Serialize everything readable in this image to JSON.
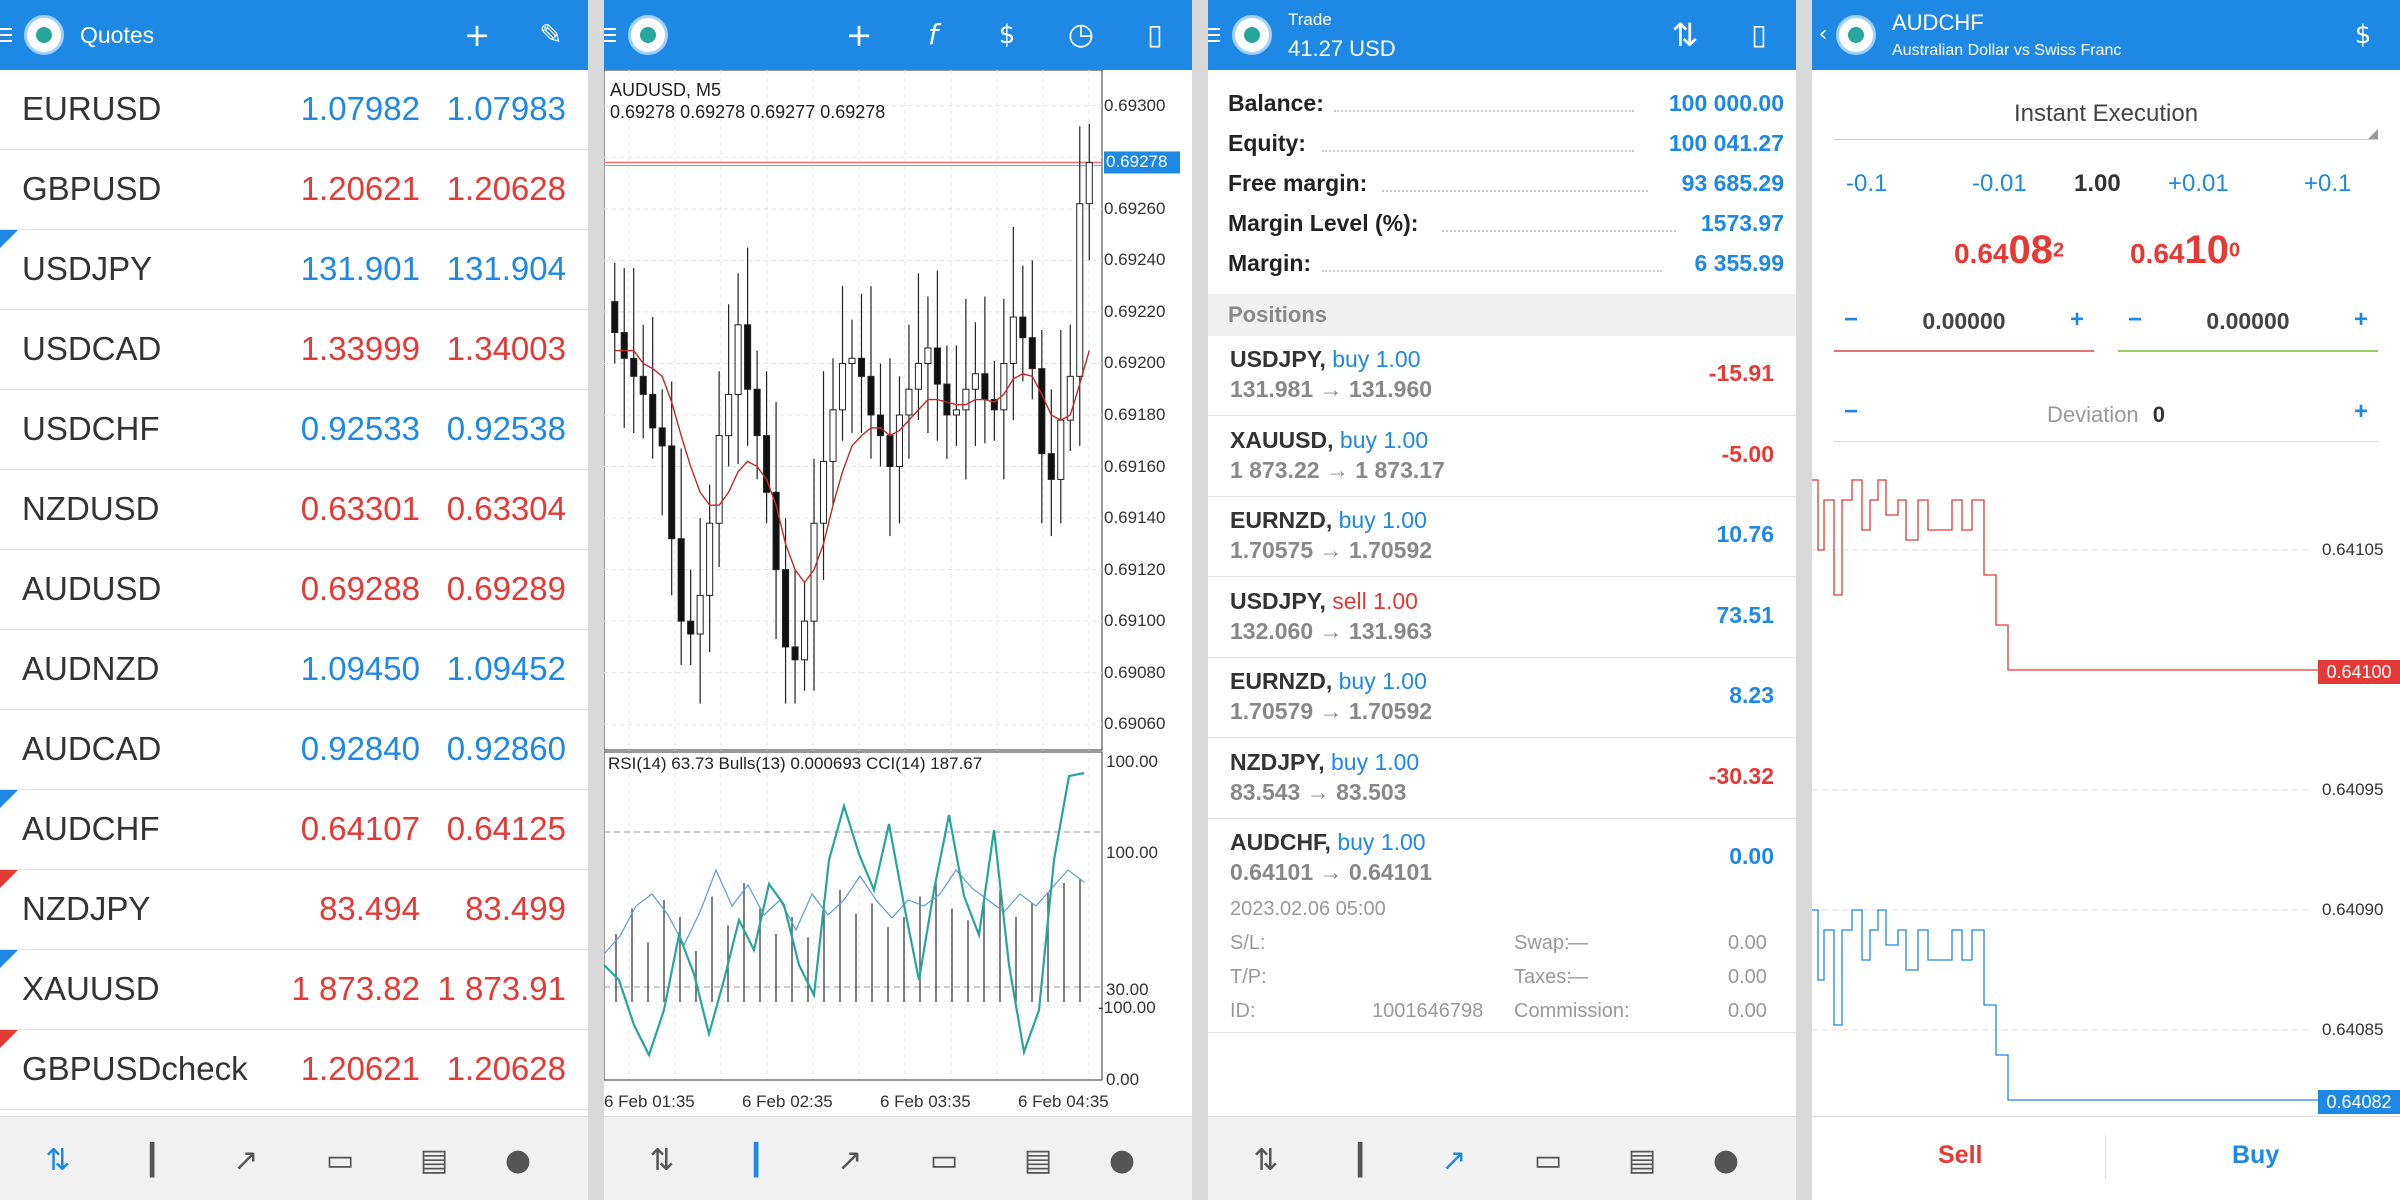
{
  "colors": {
    "accent": "#1e88e5",
    "up": "#1e88e5",
    "down": "#e53935"
  },
  "bottom_nav": [
    "quotes-icon",
    "chart-icon",
    "trade-icon",
    "history-icon",
    "news-icon",
    "chat-icon"
  ],
  "quotes": {
    "title": "Quotes",
    "rows": [
      {
        "symbol": "EURUSD",
        "bid": "1.07982",
        "ask": "1.07983",
        "dir": "up"
      },
      {
        "symbol": "GBPUSD",
        "bid": "1.20621",
        "ask": "1.20628",
        "dir": "down"
      },
      {
        "symbol": "USDJPY",
        "bid": "131.901",
        "ask": "131.904",
        "dir": "up"
      },
      {
        "symbol": "USDCAD",
        "bid": "1.33999",
        "ask": "1.34003",
        "dir": "down"
      },
      {
        "symbol": "USDCHF",
        "bid": "0.92533",
        "ask": "0.92538",
        "dir": "up"
      },
      {
        "symbol": "NZDUSD",
        "bid": "0.63301",
        "ask": "0.63304",
        "dir": "down"
      },
      {
        "symbol": "AUDUSD",
        "bid": "0.69288",
        "ask": "0.69289",
        "dir": "down"
      },
      {
        "symbol": "AUDNZD",
        "bid": "1.09450",
        "ask": "1.09452",
        "dir": "up"
      },
      {
        "symbol": "AUDCAD",
        "bid": "0.92840",
        "ask": "0.92860",
        "dir": "up"
      },
      {
        "symbol": "AUDCHF",
        "bid": "0.64107",
        "ask": "0.64125",
        "dir": "down"
      },
      {
        "symbol": "NZDJPY",
        "bid": "83.494",
        "ask": "83.499",
        "dir": "down"
      },
      {
        "symbol": "XAUUSD",
        "bid": "1 873.82",
        "ask": "1 873.91",
        "dir": "down"
      },
      {
        "symbol": "GBPUSDcheck",
        "bid": "1.20621",
        "ask": "1.20628",
        "dir": "down"
      }
    ]
  },
  "chart": {
    "symbol_label": "AUDUSD, M5",
    "ohlc_label": "0.69278 0.69278 0.69277 0.69278",
    "price_ticks": [
      "0.69300",
      "0.69260",
      "0.69240",
      "0.69220",
      "0.69200",
      "0.69180",
      "0.69160",
      "0.69140",
      "0.69120",
      "0.69100",
      "0.69080",
      "0.69060"
    ],
    "current_price": "0.69278",
    "indicator_label": "RSI(14) 63.73 Bulls(13) 0.000693 CCI(14) 187.67",
    "indicator_ticks": [
      "100.00",
      "100.00",
      "30.00",
      "-100.00",
      "0.00"
    ],
    "time_ticks": [
      "6 Feb 01:35",
      "6 Feb 02:35",
      "6 Feb 03:35",
      "6 Feb 04:35"
    ]
  },
  "chart_data": {
    "type": "line",
    "series": [
      {
        "values": [
          0.69212,
          0.69202,
          0.69195,
          0.69188,
          0.69175,
          0.69168,
          0.69132,
          0.691,
          0.69095,
          0.6911,
          0.69138,
          0.69172,
          0.69188,
          0.69215,
          0.6919,
          0.69172,
          0.6915,
          0.6912,
          0.6909,
          0.69085,
          0.691,
          0.69138,
          0.69162,
          0.69182,
          0.692,
          0.69202,
          0.69195,
          0.6918,
          0.69172,
          0.6916,
          0.6918,
          0.6919,
          0.692,
          0.69206,
          0.69192,
          0.6918,
          0.69182,
          0.6919,
          0.69196,
          0.69186,
          0.69182,
          0.692,
          0.69218,
          0.6921,
          0.69198,
          0.69165,
          0.69155,
          0.69178,
          0.69195,
          0.69262,
          0.69278
        ]
      },
      {
        "values": [
          0.69205,
          0.69205,
          0.69205,
          0.692,
          0.69198,
          0.69195,
          0.69185,
          0.69172,
          0.6916,
          0.6915,
          0.69145,
          0.69145,
          0.6915,
          0.69158,
          0.69162,
          0.6916,
          0.69155,
          0.69145,
          0.6913,
          0.6912,
          0.69115,
          0.6912,
          0.6913,
          0.69145,
          0.69158,
          0.69168,
          0.69172,
          0.69175,
          0.69175,
          0.69172,
          0.69174,
          0.69178,
          0.69182,
          0.69186,
          0.69186,
          0.69185,
          0.69184,
          0.69184,
          0.69186,
          0.69186,
          0.69185,
          0.69188,
          0.69194,
          0.69196,
          0.69195,
          0.69188,
          0.6918,
          0.69178,
          0.6918,
          0.69192,
          0.69205
        ]
      }
    ],
    "ylim": [
      0.6905,
      0.6931
    ]
  },
  "trade": {
    "title": "Trade",
    "profit": "41.27 USD",
    "account": [
      {
        "label": "Balance:",
        "value": "100 000.00"
      },
      {
        "label": "Equity:",
        "value": "100 041.27"
      },
      {
        "label": "Free margin:",
        "value": "93 685.29"
      },
      {
        "label": "Margin Level (%):",
        "value": "1573.97"
      },
      {
        "label": "Margin:",
        "value": "6 355.99"
      }
    ],
    "positions_header": "Positions",
    "positions": [
      {
        "symbol": "USDJPY,",
        "side": "buy 1.00",
        "prices": "131.981 → 131.960",
        "pl": "-15.91",
        "sign": "neg",
        "side_type": "buy"
      },
      {
        "symbol": "XAUUSD,",
        "side": "buy 1.00",
        "prices": "1 873.22 → 1 873.17",
        "pl": "-5.00",
        "sign": "neg",
        "side_type": "buy"
      },
      {
        "symbol": "EURNZD,",
        "side": "buy 1.00",
        "prices": "1.70575 → 1.70592",
        "pl": "10.76",
        "sign": "pos",
        "side_type": "buy"
      },
      {
        "symbol": "USDJPY,",
        "side": "sell 1.00",
        "prices": "132.060 → 131.963",
        "pl": "73.51",
        "sign": "pos",
        "side_type": "sell"
      },
      {
        "symbol": "EURNZD,",
        "side": "buy 1.00",
        "prices": "1.70579 → 1.70592",
        "pl": "8.23",
        "sign": "pos",
        "side_type": "buy"
      },
      {
        "symbol": "NZDJPY,",
        "side": "buy 1.00",
        "prices": "83.543 → 83.503",
        "pl": "-30.32",
        "sign": "neg",
        "side_type": "buy"
      },
      {
        "symbol": "AUDCHF,",
        "side": "buy 1.00",
        "prices": "0.64101 → 0.64101",
        "pl": "0.00",
        "sign": "pos",
        "side_type": "buy"
      }
    ],
    "detail": {
      "time": "2023.02.06 05:00",
      "sl_label": "S/L:",
      "sl_value": "—",
      "tp_label": "T/P:",
      "tp_value": "—",
      "id_label": "ID:",
      "id_value": "1001646798",
      "swap_label": "Swap:",
      "swap_value": "0.00",
      "taxes_label": "Taxes:",
      "taxes_value": "0.00",
      "commission_label": "Commission:",
      "commission_value": "0.00"
    }
  },
  "order": {
    "symbol": "AUDCHF",
    "description": "Australian Dollar vs Swiss Franc",
    "execution": "Instant Execution",
    "volume_steps": [
      "-0.1",
      "-0.01",
      "1.00",
      "+0.01",
      "+0.1"
    ],
    "sell_price_main": "0.64",
    "sell_price_big": "08",
    "sell_price_sup": "2",
    "buy_price_main": "0.64",
    "buy_price_big": "10",
    "buy_price_sup": "0",
    "sl_value": "0.00000",
    "tp_value": "0.00000",
    "deviation_label": "Deviation",
    "deviation_value": "0",
    "price_ticks": [
      "0.64105",
      "0.64095",
      "0.64090",
      "0.64085"
    ],
    "bid_tag": "0.64100",
    "ask_tag": "0.64082",
    "sell_label": "Sell",
    "buy_label": "Buy"
  }
}
